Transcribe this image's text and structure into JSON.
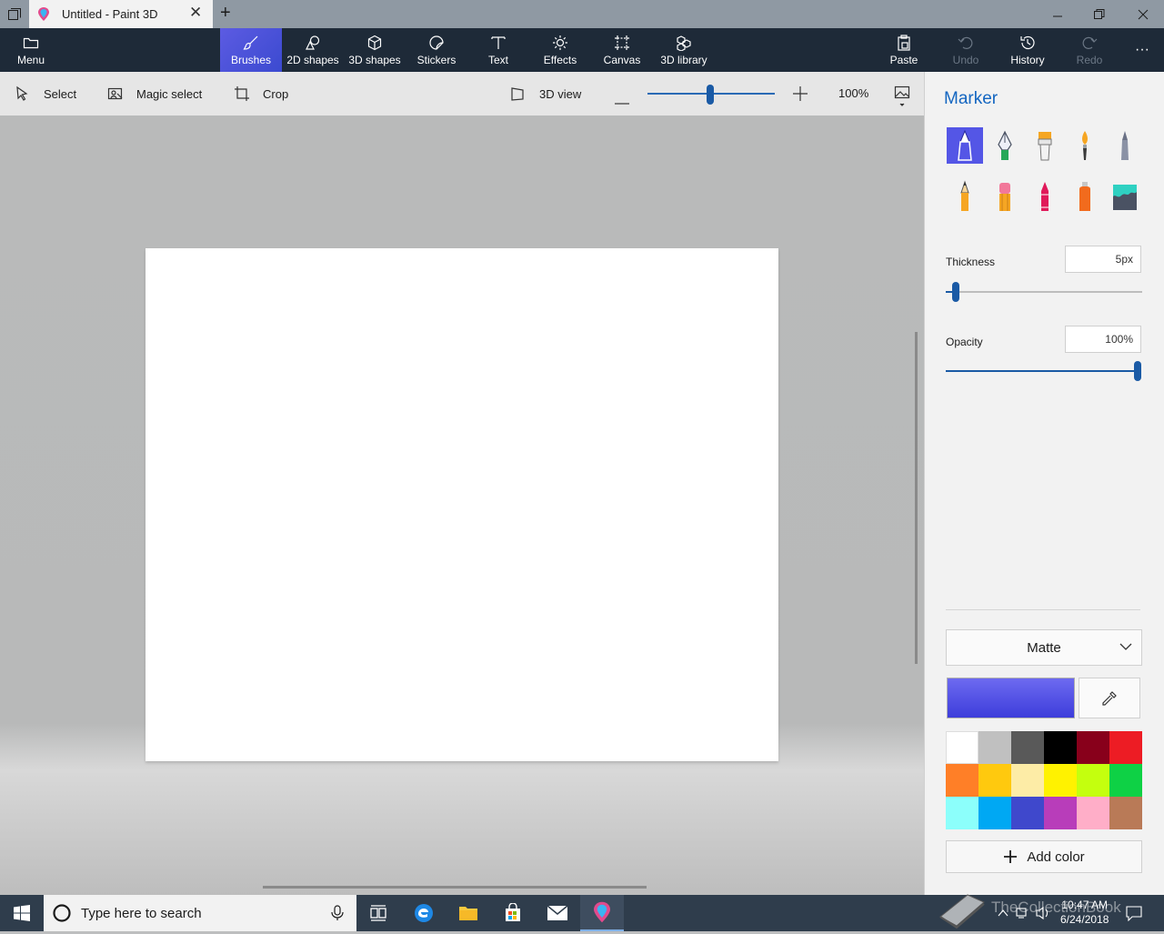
{
  "window": {
    "tab_title": "Untitled - Paint 3D",
    "close_tab_glyph": "✕",
    "new_tab_glyph": "+"
  },
  "ribbon": {
    "menu_label": "Menu",
    "tabs": [
      {
        "label": "Brushes",
        "icon": "brush-icon",
        "active": true
      },
      {
        "label": "2D shapes",
        "icon": "2d-shapes-icon"
      },
      {
        "label": "3D shapes",
        "icon": "3d-shapes-icon"
      },
      {
        "label": "Stickers",
        "icon": "stickers-icon"
      },
      {
        "label": "Text",
        "icon": "text-icon"
      },
      {
        "label": "Effects",
        "icon": "effects-icon"
      },
      {
        "label": "Canvas",
        "icon": "canvas-icon"
      },
      {
        "label": "3D library",
        "icon": "3d-library-icon"
      }
    ],
    "right": [
      {
        "label": "Paste",
        "icon": "paste-icon"
      },
      {
        "label": "Undo",
        "icon": "undo-icon",
        "disabled": true
      },
      {
        "label": "History",
        "icon": "history-icon"
      },
      {
        "label": "Redo",
        "icon": "redo-icon",
        "disabled": true
      }
    ],
    "more_glyph": "···"
  },
  "toolbar": {
    "select_label": "Select",
    "magic_select_label": "Magic select",
    "crop_label": "Crop",
    "view3d_label": "3D view",
    "zoom_value": "100%",
    "zoom_level": 0.5
  },
  "panel": {
    "title": "Marker",
    "brushes": [
      "marker",
      "calligraphy-pen",
      "oil-brush",
      "watercolor",
      "pixel-pen",
      "pencil",
      "eraser",
      "crayon",
      "spray-can",
      "fill"
    ],
    "thickness_label": "Thickness",
    "thickness_value": "5px",
    "opacity_label": "Opacity",
    "opacity_value": "100%",
    "finish_value": "Matte",
    "add_color_label": "Add color",
    "selected_color": "#3d3ddb",
    "palette": [
      "#ffffff",
      "#c0c0c0",
      "#595959",
      "#000000",
      "#88001b",
      "#ed1c24",
      "#ff7f27",
      "#ffc90e",
      "#fdeca6",
      "#fff200",
      "#c4ff0e",
      "#0ed145",
      "#8cfffb",
      "#00a8f3",
      "#3f48cc",
      "#b83dba",
      "#ffaec8",
      "#b97a57"
    ]
  },
  "taskbar": {
    "search_placeholder": "Type here to search",
    "time": "10:47 AM",
    "date": "6/24/2018",
    "watermark": "TheCollectionBook"
  }
}
